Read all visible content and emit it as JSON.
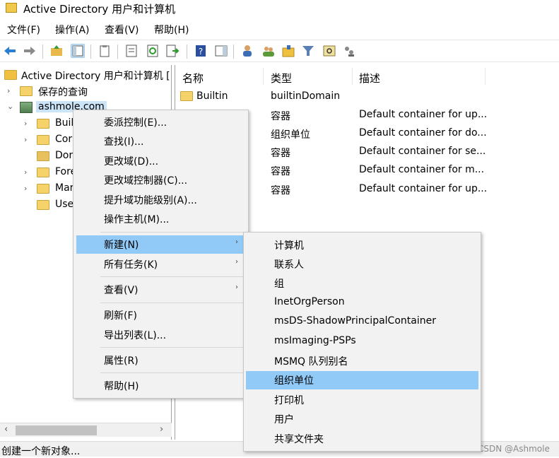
{
  "window": {
    "title": "Active Directory 用户和计算机"
  },
  "menubar": {
    "items": [
      "文件(F)",
      "操作(A)",
      "查看(V)",
      "帮助(H)"
    ]
  },
  "toolbar": {
    "icons": [
      "back-arrow-icon",
      "forward-arrow-icon",
      "up-folder-icon",
      "show-tree-icon",
      "clipboard-icon",
      "properties-icon",
      "refresh-icon",
      "export-list-icon",
      "help-icon",
      "action-pane-icon",
      "new-user-icon",
      "new-group-icon",
      "new-ou-icon",
      "filter-icon",
      "find-icon",
      "delegate-icon"
    ]
  },
  "tree": {
    "root": "Active Directory 用户和计算机 [",
    "saved_queries": "保存的查询",
    "domain": "ashmole.com",
    "children": [
      "Buil",
      "Cor",
      "Dor",
      "Fore",
      "Mar",
      "Use"
    ]
  },
  "list": {
    "headers": {
      "name": "名称",
      "type": "类型",
      "desc": "描述"
    },
    "rows": [
      {
        "name": "Builtin",
        "type": "builtinDomain",
        "desc": ""
      },
      {
        "name": "",
        "type": "容器",
        "desc": "Default container for up..."
      },
      {
        "name": "",
        "type": "组织单位",
        "desc": "Default container for do..."
      },
      {
        "name": "",
        "type": "容器",
        "desc": "Default container for se..."
      },
      {
        "name": "",
        "type": "容器",
        "desc": "Default container for m..."
      },
      {
        "name": "",
        "type": "容器",
        "desc": "Default container for up..."
      }
    ]
  },
  "context_menu": {
    "items": [
      "委派控制(E)...",
      "查找(I)...",
      "更改域(D)...",
      "更改域控制器(C)...",
      "提升域功能级别(A)...",
      "操作主机(M)...",
      "新建(N)",
      "所有任务(K)",
      "查看(V)",
      "刷新(F)",
      "导出列表(L)...",
      "属性(R)",
      "帮助(H)"
    ],
    "highlighted": "新建(N)"
  },
  "submenu": {
    "items": [
      "计算机",
      "联系人",
      "组",
      "InetOrgPerson",
      "msDS-ShadowPrincipalContainer",
      "msImaging-PSPs",
      "MSMQ 队列别名",
      "组织单位",
      "打印机",
      "用户",
      "共享文件夹"
    ],
    "highlighted": "组织单位"
  },
  "status": {
    "text": "创建一个新对象..."
  },
  "watermark": "CSDN @Ashmole",
  "colors": {
    "highlight": "#91c9f7",
    "selection": "#cce4f7",
    "folder": "#f6d26b"
  }
}
